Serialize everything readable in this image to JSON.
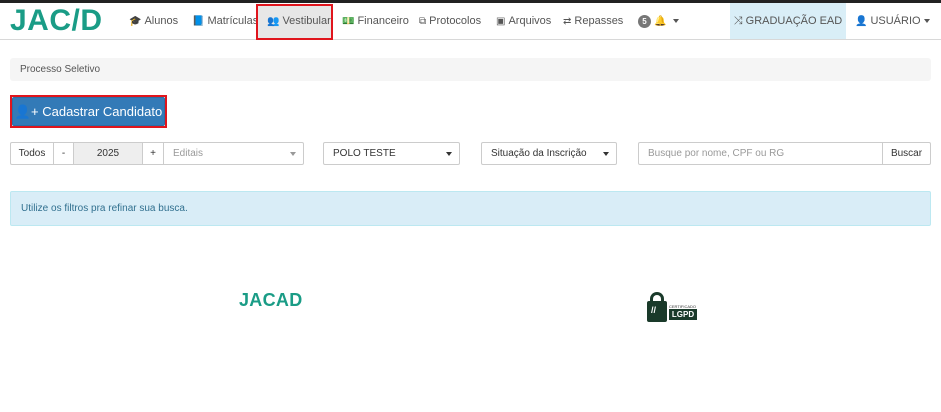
{
  "brand": {
    "logo_text_1": "JAC",
    "logo_slash": "/",
    "logo_text_2": "D"
  },
  "nav": {
    "alunos": "Alunos",
    "matriculas": "Matrículas",
    "vestibular": "Vestibular",
    "financeiro": "Financeiro",
    "protocolos": "Protocolos",
    "arquivos": "Arquivos",
    "repasses": "Repasses",
    "notifications_count": "5",
    "graduacao": "GRADUAÇÃO EAD",
    "usuario": "USUÁRIO"
  },
  "breadcrumb": "Processo Seletivo",
  "cadastrar_label": "Cadastrar Candidato",
  "filters": {
    "todos": "Todos",
    "minus": "-",
    "year": "2025",
    "plus": "+",
    "editais_placeholder": "Editais",
    "polo": "POLO TESTE",
    "situacao": "Situação da Inscrição",
    "search_placeholder": "Busque por nome, CPF ou RG",
    "buscar": "Buscar"
  },
  "alert": "Utilize os filtros pra refinar sua busca.",
  "footer": {
    "logo": "JACAD",
    "lgpd_small": "CERTIFICADO",
    "lgpd": "LGPD",
    "lgpd_mark": "//"
  }
}
